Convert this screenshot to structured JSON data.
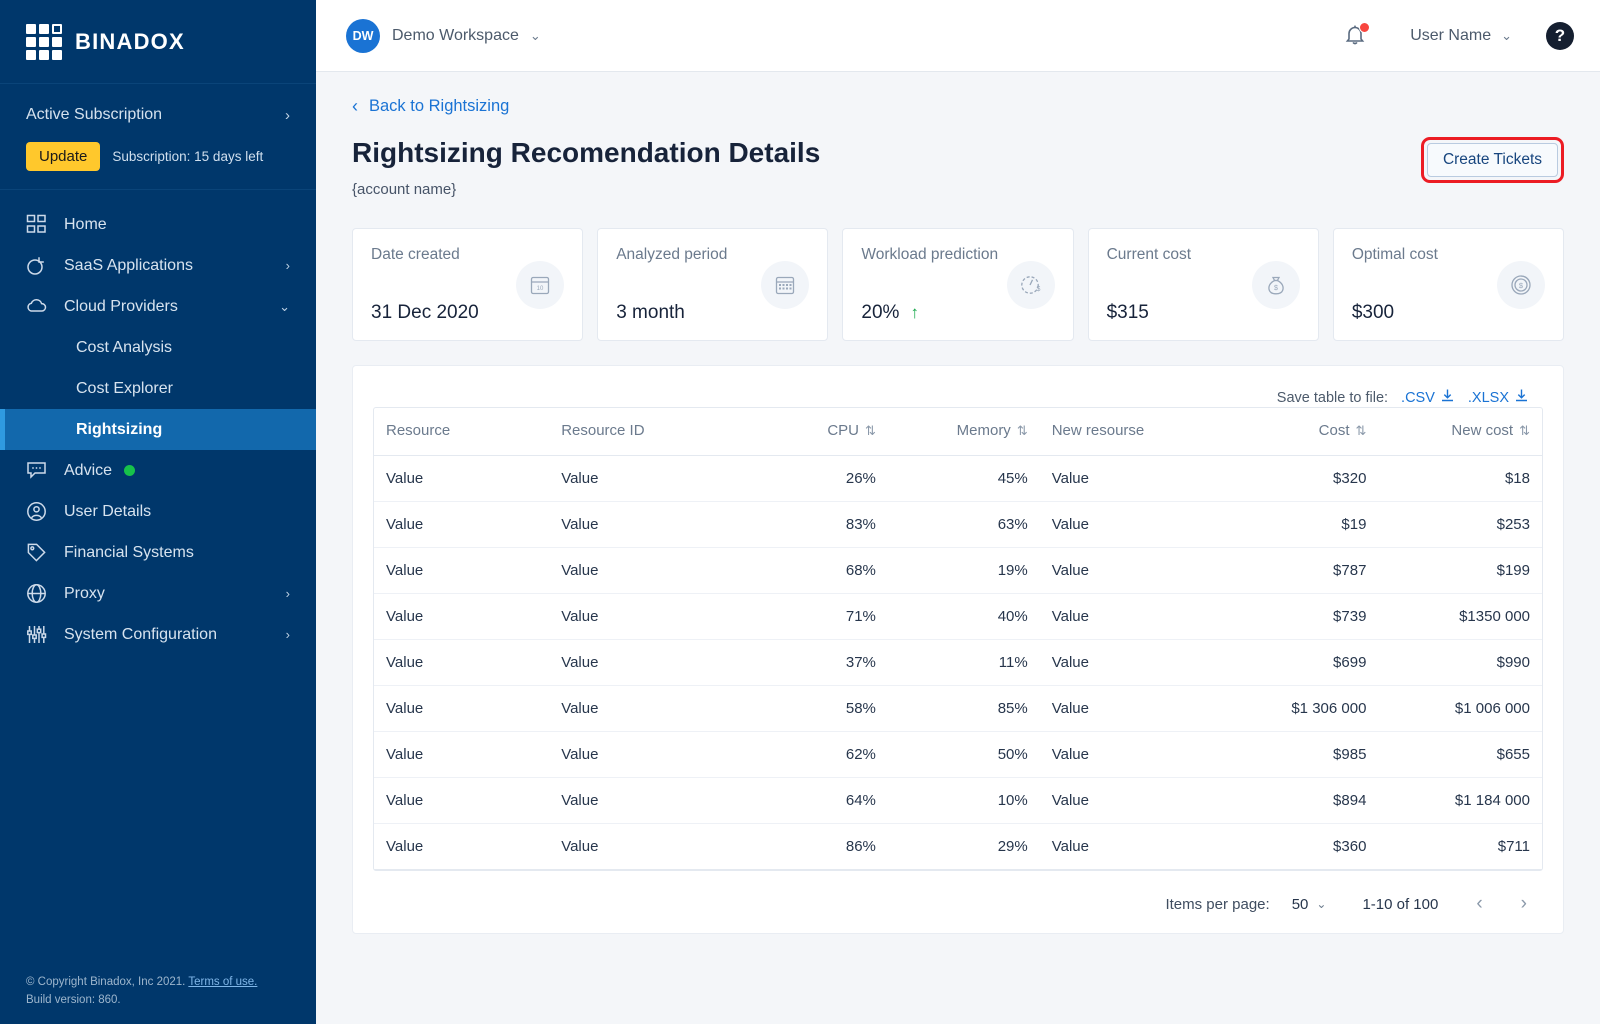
{
  "sidebar": {
    "brand": "BINADOX",
    "logo_icon": "grid-logo-icon",
    "subscription": {
      "title": "Active Subscription",
      "chevron_icon": "chevron-right-icon",
      "update_label": "Update",
      "note": "Subscription: 15 days left"
    },
    "items": [
      {
        "label": "Home",
        "icon": "home-grid-icon",
        "chevron": "",
        "level": "top",
        "active": false
      },
      {
        "label": "SaaS Applications",
        "icon": "pie-chart-icon",
        "chevron": "›",
        "level": "top",
        "active": false
      },
      {
        "label": "Cloud Providers",
        "icon": "cloud-icon",
        "chevron": "⌄",
        "level": "top",
        "active": false
      },
      {
        "label": "Cost Analysis",
        "icon": "",
        "chevron": "",
        "level": "sub",
        "active": false
      },
      {
        "label": "Cost Explorer",
        "icon": "",
        "chevron": "",
        "level": "sub",
        "active": false
      },
      {
        "label": "Rightsizing",
        "icon": "",
        "chevron": "",
        "level": "sub",
        "active": true
      },
      {
        "label": "Advice",
        "icon": "chat-bubble-icon",
        "chevron": "",
        "level": "top",
        "active": false,
        "dot": true
      },
      {
        "label": "User Details",
        "icon": "user-circle-icon",
        "chevron": "",
        "level": "top",
        "active": false
      },
      {
        "label": "Financial Systems",
        "icon": "tag-icon",
        "chevron": "",
        "level": "top",
        "active": false
      },
      {
        "label": "Proxy",
        "icon": "globe-icon",
        "chevron": "›",
        "level": "top",
        "active": false
      },
      {
        "label": "System Configuration",
        "icon": "sliders-icon",
        "chevron": "›",
        "level": "top",
        "active": false
      }
    ],
    "footer": {
      "copyright": "© Copyright Binadox, Inc 2021.",
      "terms": "Terms of use.",
      "build": "Build version: 860."
    }
  },
  "topbar": {
    "workspace_initials": "DW",
    "workspace_name": "Demo Workspace",
    "workspace_chevron_icon": "chevron-down-icon",
    "bell_icon": "notification-bell-icon",
    "user_name": "User Name",
    "user_chevron_icon": "chevron-down-icon",
    "help_label": "?",
    "help_icon": "help-circle-icon"
  },
  "page": {
    "back_link": "Back to Rightsizing",
    "back_icon": "chevron-left-icon",
    "title": "Rightsizing Recomendation Details",
    "account_name": "{account name}",
    "create_tickets_label": "Create Tickets"
  },
  "cards": [
    {
      "label": "Date created",
      "value": "31 Dec 2020",
      "icon": "calendar-day-icon",
      "trend": ""
    },
    {
      "label": "Analyzed period",
      "value": "3 month",
      "icon": "calendar-month-icon",
      "trend": ""
    },
    {
      "label": "Workload prediction",
      "value": "20%",
      "icon": "gauge-dollar-icon",
      "trend": "↑"
    },
    {
      "label": "Current cost",
      "value": "$315",
      "icon": "money-bag-icon",
      "trend": ""
    },
    {
      "label": "Optimal cost",
      "value": "$300",
      "icon": "coin-dollar-icon",
      "trend": ""
    }
  ],
  "table": {
    "save_label": "Save table to file:",
    "csv_label": ".CSV",
    "xlsx_label": ".XLSX",
    "download_icon": "download-icon",
    "sort_icon": "sort-updown-icon",
    "columns": [
      {
        "label": "Resource",
        "sortable": false,
        "align": "left"
      },
      {
        "label": "Resource ID",
        "sortable": false,
        "align": "left"
      },
      {
        "label": "CPU",
        "sortable": true,
        "align": "right"
      },
      {
        "label": "Memory",
        "sortable": true,
        "align": "right"
      },
      {
        "label": "New resourse",
        "sortable": false,
        "align": "left"
      },
      {
        "label": "Cost",
        "sortable": true,
        "align": "right"
      },
      {
        "label": "New cost",
        "sortable": true,
        "align": "right"
      }
    ],
    "rows": [
      [
        "Value",
        "Value",
        "26%",
        "45%",
        "Value",
        "$320",
        "$18"
      ],
      [
        "Value",
        "Value",
        "83%",
        "63%",
        "Value",
        "$19",
        "$253"
      ],
      [
        "Value",
        "Value",
        "68%",
        "19%",
        "Value",
        "$787",
        "$199"
      ],
      [
        "Value",
        "Value",
        "71%",
        "40%",
        "Value",
        "$739",
        "$1350 000"
      ],
      [
        "Value",
        "Value",
        "37%",
        "11%",
        "Value",
        "$699",
        "$990"
      ],
      [
        "Value",
        "Value",
        "58%",
        "85%",
        "Value",
        "$1 306 000",
        "$1 006 000"
      ],
      [
        "Value",
        "Value",
        "62%",
        "50%",
        "Value",
        "$985",
        "$655"
      ],
      [
        "Value",
        "Value",
        "64%",
        "10%",
        "Value",
        "$894",
        "$1 184 000"
      ],
      [
        "Value",
        "Value",
        "86%",
        "29%",
        "Value",
        "$360",
        "$711"
      ]
    ]
  },
  "pagination": {
    "items_per_page_label": "Items per page:",
    "items_per_page_value": "50",
    "chevron_icon": "chevron-down-icon",
    "range": "1-10 of 100",
    "prev_icon": "chevron-left-icon",
    "next_icon": "chevron-right-icon"
  },
  "colors": {
    "sidebar_bg": "#00376b",
    "sidebar_active": "#1268ac",
    "accent_blue": "#1a73d4",
    "update_yellow": "#ffc82c",
    "highlight_red": "#ec1c24",
    "trend_green": "#18a84b"
  }
}
